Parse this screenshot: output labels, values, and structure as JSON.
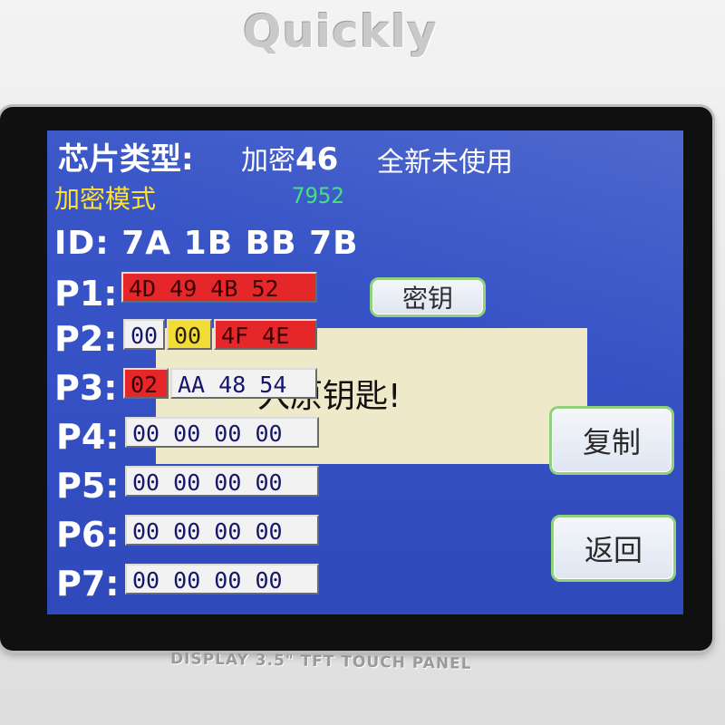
{
  "device": {
    "brand": "Quickly",
    "panel_caption": "DISPLAY 3.5\" TFT TOUCH PANEL"
  },
  "header": {
    "chip_type_label": "芯片类型:",
    "chip_type_prefix": "加密",
    "chip_type_number": "46",
    "chip_status": "全新未使用",
    "mode_label": "加密模式",
    "mode_code": "7952",
    "id_line": "ID: 7A 1B BB 7B"
  },
  "pages": [
    {
      "label": "P1:",
      "cells": [
        {
          "text": "4D 49 4B 52",
          "color": "red"
        }
      ]
    },
    {
      "label": "P2:",
      "cells": [
        {
          "text": "00",
          "color": "white"
        },
        {
          "text": "00",
          "color": "yellow"
        },
        {
          "text": "4F 4E",
          "color": "red"
        }
      ]
    },
    {
      "label": "P3:",
      "cells": [
        {
          "text": "02",
          "color": "red"
        },
        {
          "text": "AA 48 54",
          "color": "white"
        }
      ]
    },
    {
      "label": "P4:",
      "cells": [
        {
          "text": "00 00 00 00",
          "color": "white"
        }
      ]
    },
    {
      "label": "P5:",
      "cells": [
        {
          "text": "00 00 00 00",
          "color": "white"
        }
      ]
    },
    {
      "label": "P6:",
      "cells": [
        {
          "text": "00 00 00 00",
          "color": "white"
        }
      ]
    },
    {
      "label": "P7:",
      "cells": [
        {
          "text": "00 00 00 00",
          "color": "white"
        }
      ]
    }
  ],
  "dialog": {
    "message_visible": "入原钥匙!"
  },
  "buttons": {
    "key": "密钥",
    "copy": "复制",
    "back": "返回"
  },
  "colors": {
    "screen_blue": "#3551c4",
    "cell_red": "#e5272a",
    "cell_white": "#f2f2f2",
    "cell_yellow": "#f2dd36",
    "mode_label_yellow": "#ffe033",
    "mode_code_green": "#3ee07a",
    "button_border_green": "#8fd27a"
  }
}
